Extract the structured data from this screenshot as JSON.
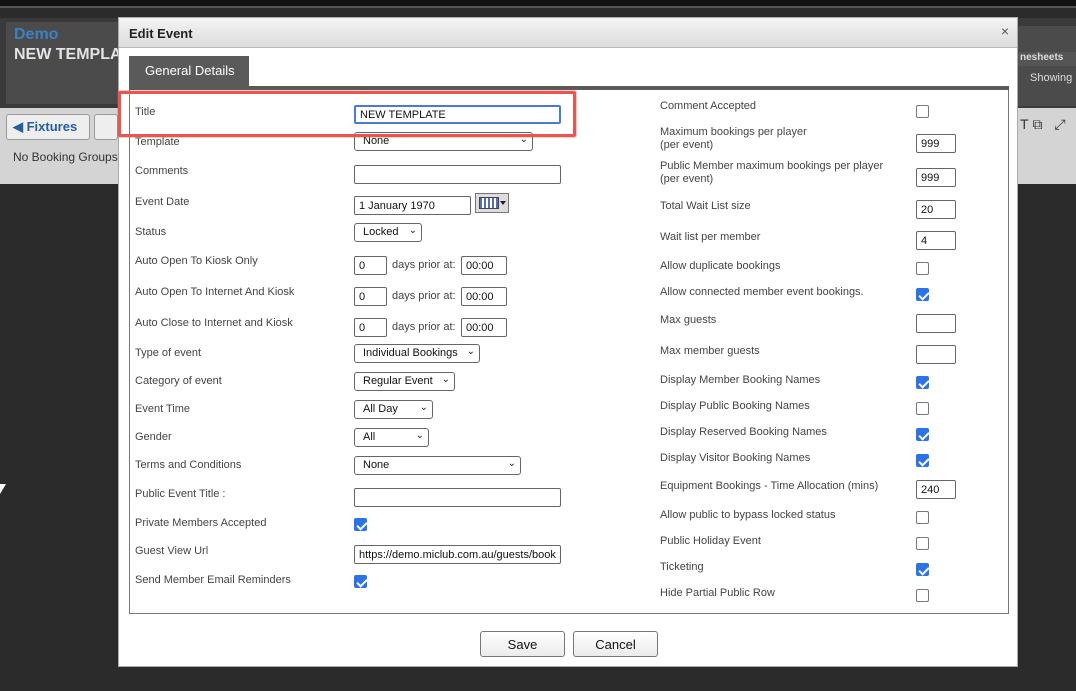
{
  "background": {
    "app_title": "Demo",
    "event_name": "NEW TEMPLA",
    "timesheets_label": "nesheets",
    "showing_label": "Showing",
    "fixtures_button": "Fixtures",
    "no_groups_text": "No Booking Groups"
  },
  "modal": {
    "title": "Edit Event",
    "close": "×",
    "tab": "General Details"
  },
  "left": {
    "title": {
      "label": "Title",
      "value": "NEW TEMPLATE"
    },
    "template": {
      "label": "Template",
      "value": "None"
    },
    "comments": {
      "label": "Comments",
      "value": ""
    },
    "event_date": {
      "label": "Event Date",
      "value": "1 January 1970"
    },
    "status": {
      "label": "Status",
      "value": "Locked"
    },
    "kiosk_only": {
      "label": "Auto Open To Kiosk Only",
      "days": "0",
      "prior": "days prior at:",
      "time": "00:00"
    },
    "internet_kiosk": {
      "label": "Auto Open To Internet And Kiosk",
      "days": "0",
      "prior": "days prior at:",
      "time": "00:00"
    },
    "auto_close": {
      "label": "Auto Close to Internet and Kiosk",
      "days": "0",
      "prior": "days prior at:",
      "time": "00:00"
    },
    "type": {
      "label": "Type of event",
      "value": "Individual Bookings"
    },
    "category": {
      "label": "Category of event",
      "value": "Regular Event"
    },
    "event_time": {
      "label": "Event Time",
      "value": "All Day"
    },
    "gender": {
      "label": "Gender",
      "value": "All"
    },
    "terms": {
      "label": "Terms and Conditions",
      "value": "None"
    },
    "public_title": {
      "label": "Public Event Title :",
      "value": ""
    },
    "private_members": {
      "label": "Private Members Accepted",
      "checked": true
    },
    "guest_url": {
      "label": "Guest View Url",
      "value": "https://demo.miclub.com.au/guests/book"
    },
    "email_reminders": {
      "label": "Send Member Email Reminders",
      "checked": true
    }
  },
  "right": {
    "comment_accepted": {
      "label": "Comment Accepted",
      "checked": false
    },
    "max_per_player": {
      "label1": "Maximum bookings per player",
      "label2": "(per event)",
      "value": "999"
    },
    "public_max": {
      "label1": "Public Member maximum bookings per player",
      "label2": "(per event)",
      "value": "999"
    },
    "wait_list_size": {
      "label": "Total Wait List size",
      "value": "20"
    },
    "wait_per_member": {
      "label": "Wait list per member",
      "value": "4"
    },
    "allow_duplicate": {
      "label": "Allow duplicate bookings",
      "checked": false
    },
    "allow_connected": {
      "label": "Allow connected member event bookings.",
      "checked": true
    },
    "max_guests": {
      "label": "Max guests",
      "value": ""
    },
    "max_member_guests": {
      "label": "Max member guests",
      "value": ""
    },
    "display_member": {
      "label": "Display Member Booking Names",
      "checked": true
    },
    "display_public": {
      "label": "Display Public Booking Names",
      "checked": false
    },
    "display_reserved": {
      "label": "Display Reserved Booking Names",
      "checked": true
    },
    "display_visitor": {
      "label": "Display Visitor Booking Names",
      "checked": true
    },
    "equipment": {
      "label": "Equipment Bookings - Time Allocation (mins)",
      "value": "240"
    },
    "bypass_locked": {
      "label": "Allow public to bypass locked status",
      "checked": false
    },
    "public_holiday": {
      "label": "Public Holiday Event",
      "checked": false
    },
    "ticketing": {
      "label": "Ticketing",
      "checked": true
    },
    "hide_partial": {
      "label": "Hide Partial Public Row",
      "checked": false
    }
  },
  "footer": {
    "save": "Save",
    "cancel": "Cancel"
  },
  "colors": {
    "accent": "#2c74e6",
    "highlight": "#e8574f",
    "tab": "#5a5a5a"
  }
}
